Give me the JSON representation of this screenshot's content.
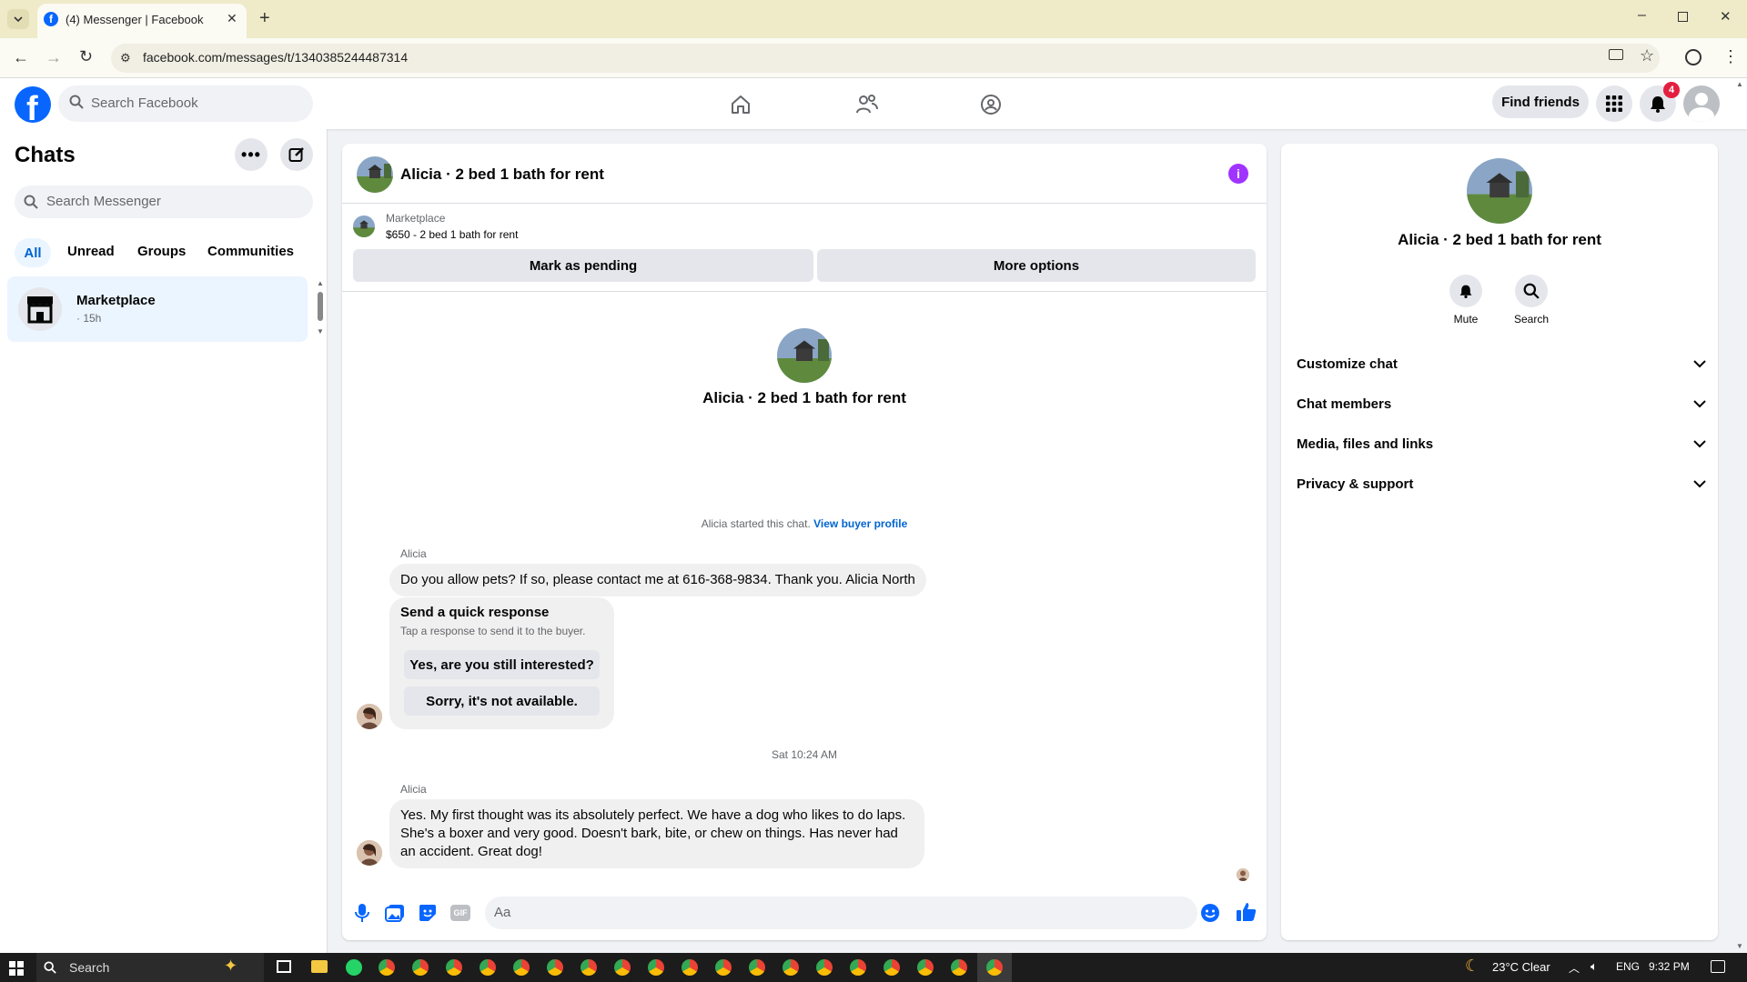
{
  "browser": {
    "tab_title": "(4) Messenger | Facebook",
    "url": "facebook.com/messages/t/1340385244487314"
  },
  "header": {
    "search_placeholder": "Search Facebook",
    "find_friends": "Find friends",
    "notification_count": "4"
  },
  "sidebar": {
    "title": "Chats",
    "search_placeholder": "Search Messenger",
    "filters": [
      "All",
      "Unread",
      "Groups",
      "Communities"
    ],
    "chats": [
      {
        "name": "Marketplace",
        "time": "· 15h"
      }
    ]
  },
  "conversation": {
    "title": "Alicia · 2 bed 1 bath for rent",
    "marketplace_label": "Marketplace",
    "listing": "$650 - 2 bed 1 bath for rent",
    "mark_pending": "Mark as pending",
    "more_options": "More options",
    "intro_title": "Alicia · 2 bed 1 bath for rent",
    "started_text": "Alicia started this chat.",
    "view_buyer": "View buyer profile",
    "messages": [
      {
        "sender": "Alicia",
        "text": "Do you allow pets? If so, please contact me at 616-368-9834. Thank you. Alicia North"
      },
      {
        "sender": "Alicia",
        "text": "Yes. My first thought was its absolutely perfect. We have a dog who likes to do laps. She's a boxer and very good. Doesn't bark, bite, or chew on things. Has never had an accident. Great dog!"
      }
    ],
    "quick_response": {
      "title": "Send a quick response",
      "subtitle": "Tap a response to send it to the buyer.",
      "options": [
        "Yes, are you still interested?",
        "Sorry, it's not available."
      ]
    },
    "timestamp": "Sat 10:24 AM",
    "composer_placeholder": "Aa"
  },
  "details": {
    "title": "Alicia · 2 bed 1 bath for rent",
    "actions": [
      "Mute",
      "Search"
    ],
    "sections": [
      "Customize chat",
      "Chat members",
      "Media, files and links",
      "Privacy & support"
    ]
  },
  "taskbar": {
    "search": "Search",
    "weather": "23°C  Clear",
    "lang": "ENG",
    "time": "9:32 PM"
  },
  "colors": {
    "fb_blue": "#0866ff",
    "accent_purple": "#a033ff",
    "selected_bg": "#ebf5ff"
  }
}
